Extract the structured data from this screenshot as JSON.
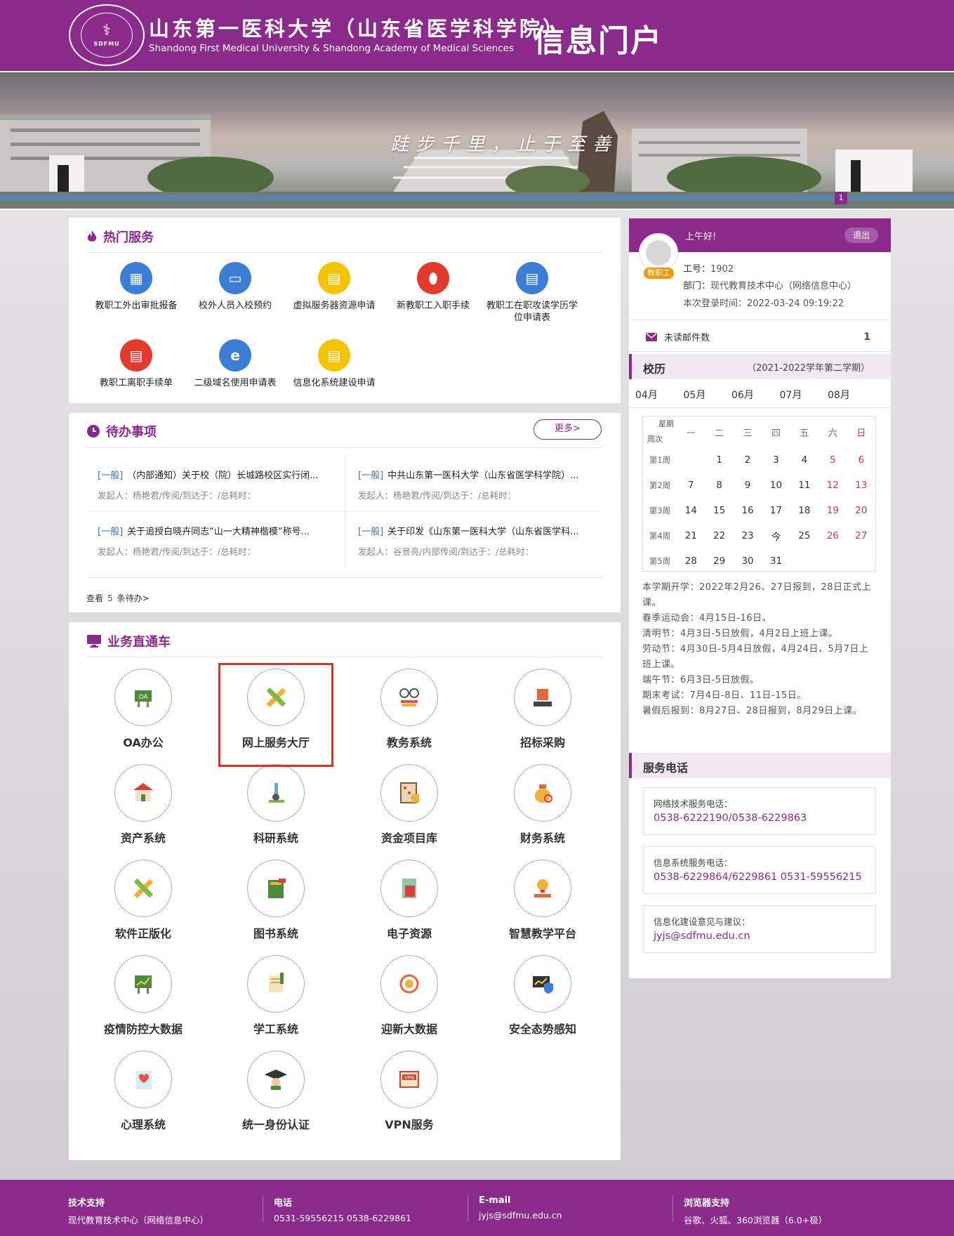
{
  "header": {
    "logo_abbr": "SDFMU",
    "university_cn": "山东第一医科大学（山东省医学科学院）",
    "university_en": "Shandong First Medical University & Shandong Academy of Medical Sciences",
    "portal_title": "信息门户"
  },
  "banner": {
    "motto": "跬步千里，止于至善",
    "slide_index": "1"
  },
  "hot_services": {
    "title": "热门服务",
    "items": [
      {
        "label": "教职工外出审批报备",
        "icon": "calendar-clock-icon",
        "color": "#3a7fd5"
      },
      {
        "label": "校外人员入校预约",
        "icon": "wallet-icon",
        "color": "#3a7fd5"
      },
      {
        "label": "虚拟服务器资源申请",
        "icon": "document-icon",
        "color": "#f5c400"
      },
      {
        "label": "新教职工入职手续",
        "icon": "stamp-icon",
        "color": "#e23b2e"
      },
      {
        "label": "教职工在职攻读学历学位申请表",
        "icon": "document-gear-icon",
        "color": "#3a7fd5"
      },
      {
        "label": "教职工离职手续单",
        "icon": "document-exit-icon",
        "color": "#e23b2e"
      },
      {
        "label": "二级域名使用申请表",
        "icon": "ie-browser-icon",
        "color": "#3a7fd5"
      },
      {
        "label": "信息化系统建设申请",
        "icon": "document-icon",
        "color": "#f5c400"
      }
    ]
  },
  "todo": {
    "title": "待办事项",
    "more_label": "更多>",
    "items": [
      {
        "tag": "[一般]",
        "title": "（内部通知）关于校（院）长城路校区实行闭...",
        "meta": "发起人：杨艳君/传阅/到达于：/总耗时："
      },
      {
        "tag": "[一般]",
        "title": "中共山东第一医科大学（山东省医学科学院）...",
        "meta": "发起人：杨艳君/传阅/到达于：/总耗时："
      },
      {
        "tag": "[一般]",
        "title": "关于追授白晓卉同志“山一大精神楷模”称号...",
        "meta": "发起人：杨艳君/传阅/到达于：/总耗时："
      },
      {
        "tag": "[一般]",
        "title": "关于印发《山东第一医科大学（山东省医学科...",
        "meta": "发起人：谷景亮/内部传阅/到达于：/总耗时："
      }
    ],
    "view_prefix": "查看",
    "view_count": "5",
    "view_suffix": "条待办>"
  },
  "business": {
    "title": "业务直通车",
    "items": [
      {
        "label": "OA办公",
        "icon": "oa-board-icon"
      },
      {
        "label": "网上服务大厅",
        "icon": "ruler-pencil-icon"
      },
      {
        "label": "教务系统",
        "icon": "glasses-book-icon"
      },
      {
        "label": "招标采购",
        "icon": "cube-laptop-icon"
      },
      {
        "label": "资产系统",
        "icon": "building-icon"
      },
      {
        "label": "科研系统",
        "icon": "microscope-icon"
      },
      {
        "label": "资金项目库",
        "icon": "abacus-icon"
      },
      {
        "label": "财务系统",
        "icon": "money-bag-icon"
      },
      {
        "label": "软件正版化",
        "icon": "ruler-pencil-icon"
      },
      {
        "label": "图书系统",
        "icon": "books-icon"
      },
      {
        "label": "电子资源",
        "icon": "calculator-icon"
      },
      {
        "label": "智慧教学平台",
        "icon": "lightbulb-book-icon"
      },
      {
        "label": "疫情防控大数据",
        "icon": "chart-board-icon"
      },
      {
        "label": "学工系统",
        "icon": "documents-icon"
      },
      {
        "label": "迎新大数据",
        "icon": "coin-cycle-icon"
      },
      {
        "label": "安全态势感知",
        "icon": "shield-monitor-icon"
      },
      {
        "label": "心理系统",
        "icon": "heart-pulse-icon"
      },
      {
        "label": "统一身份认证",
        "icon": "graduate-icon"
      },
      {
        "label": "VPN服务",
        "icon": "vpn-icon"
      }
    ]
  },
  "user": {
    "greeting": "上午好!",
    "logout_label": "退出",
    "role": "教职工",
    "id_label": "工号：",
    "id_value": "1902",
    "dept_label": "部门：",
    "dept_value": "现代教育技术中心（网络信息中心）",
    "login_label": "本次登录时间：",
    "login_value": "2022-03-24 09:19:22",
    "mail_label": "未读邮件数",
    "mail_count": "1"
  },
  "calendar": {
    "title": "校历",
    "semester": "（2021-2022学年第二学期）",
    "months": [
      "04月",
      "05月",
      "06月",
      "07月",
      "08月"
    ],
    "corner_top": "星期",
    "corner_bottom": "周次",
    "weekdays": [
      "一",
      "二",
      "三",
      "四",
      "五",
      "六",
      "日"
    ],
    "weeks": [
      {
        "label": "第1周",
        "days": [
          "",
          "1",
          "2",
          "3",
          "4",
          "5",
          "6"
        ]
      },
      {
        "label": "第2周",
        "days": [
          "7",
          "8",
          "9",
          "10",
          "11",
          "12",
          "13"
        ]
      },
      {
        "label": "第3周",
        "days": [
          "14",
          "15",
          "16",
          "17",
          "18",
          "19",
          "20"
        ]
      },
      {
        "label": "第4周",
        "days": [
          "21",
          "22",
          "23",
          "今",
          "25",
          "26",
          "27"
        ]
      },
      {
        "label": "第5周",
        "days": [
          "28",
          "29",
          "30",
          "31",
          "",
          "",
          ""
        ]
      }
    ],
    "notes": [
      "本学期开学：2022年2月26、27日报到，28日正式上课。",
      "春季运动会：4月15日-16日。",
      "清明节：4月3日-5日放假，4月2日上班上课。",
      "劳动节：4月30日-5月4日放假，4月24日、5月7日上班上课。",
      "端午节：6月3日-5日放假。",
      "期末考试：7月4日-8日、11日-15日。",
      "暑假后报到：8月27日、28日报到，8月29日上课。"
    ]
  },
  "service_phone": {
    "title": "服务电话",
    "items": [
      {
        "label": "网络技术服务电话：",
        "value": "0538-6222190/0538-6229863"
      },
      {
        "label": "信息系统服务电话：",
        "value": "0538-6229864/6229861 0531-59556215"
      },
      {
        "label": "信息化建设意见与建议：",
        "value": "jyjs@sdfmu.edu.cn"
      }
    ]
  },
  "footer": {
    "cols": [
      {
        "head": "技术支持",
        "text": "现代教育技术中心（网络信息中心）"
      },
      {
        "head": "电话",
        "text": "0531-59556215 0538-6229861"
      },
      {
        "head": "E-mail",
        "text": "jyjs@sdfmu.edu.cn"
      },
      {
        "head": "浏览器支持",
        "text": "谷歌、火狐、360浏览器（6.0+极）"
      }
    ]
  },
  "colors": {
    "brand": "#8a2b8b",
    "highlight": "#e3301f"
  }
}
